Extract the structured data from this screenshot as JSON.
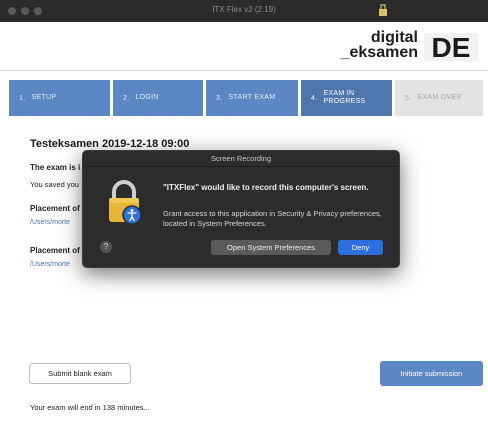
{
  "window": {
    "title": "ITX Flex v2 (2.19)"
  },
  "brand": {
    "line1": "digital",
    "line2": "_eksamen",
    "logo_text": "DE"
  },
  "steps": [
    {
      "num": "1.",
      "label": "SETUP",
      "state": "done"
    },
    {
      "num": "2.",
      "label": "LOGIN",
      "state": "done"
    },
    {
      "num": "3.",
      "label": "START EXAM",
      "state": "done"
    },
    {
      "num": "4.",
      "label": "EXAM IN\nPROGRESS",
      "state": "active"
    },
    {
      "num": "5.",
      "label": "EXAM OVER",
      "state": "disabled"
    }
  ],
  "main": {
    "exam_title": "Testeksamen 2019-12-18 09:00",
    "line_exam_is": "The exam is i",
    "line_saved": "You saved you",
    "placement1_label": "Placement of",
    "placement1_path": "/Users/morte",
    "placement2_label": "Placement of",
    "placement2_path": "/Users/morte"
  },
  "actions": {
    "submit_blank_label": "Submit blank exam",
    "initiate_submission_label": "Initiate submission"
  },
  "footer": {
    "time_remaining_text": "Your exam will end in 138 minutes..."
  },
  "dialog": {
    "title": "Screen Recording",
    "heading": "\"ITXFlex\" would like to record this computer's screen.",
    "body": "Grant access to this application in Security & Privacy preferences, located in System Preferences.",
    "help_glyph": "?",
    "open_prefs_label": "Open System Preferences",
    "deny_label": "Deny"
  },
  "colors": {
    "step_blue": "#5b87c4",
    "step_active": "#4f76ad",
    "deny_blue": "#2e6fe0",
    "dialog_bg": "#2c2c2c"
  },
  "icons": [
    "lock-icon",
    "accessibility-badge-icon",
    "help-icon",
    "app-title-icon"
  ]
}
